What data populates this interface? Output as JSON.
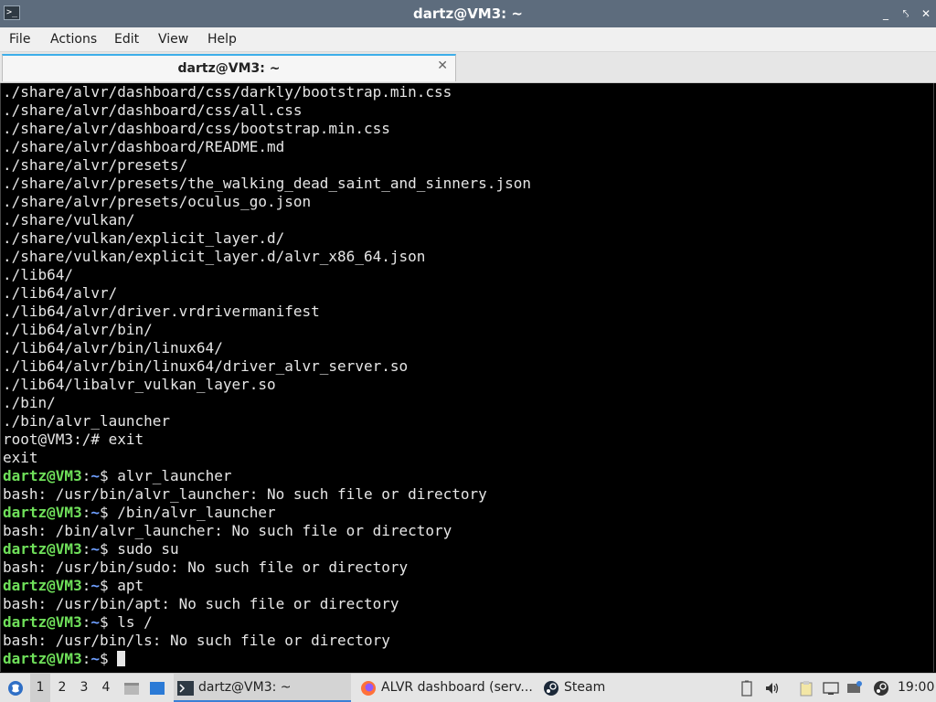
{
  "window": {
    "title": "dartz@VM3: ~",
    "controls": [
      "_",
      "⤣",
      "✕"
    ]
  },
  "menubar": {
    "items": [
      "File",
      "Actions",
      "Edit",
      "View",
      "Help"
    ]
  },
  "tabs": [
    {
      "label": "dartz@VM3: ~",
      "close": "✕"
    }
  ],
  "terminal": {
    "prompt": {
      "user": "dartz@VM3",
      "sep": ":",
      "path": "~",
      "symbol": "$"
    },
    "lines": [
      {
        "text": "./share/alvr/dashboard/css/darkly/bootstrap.min.css"
      },
      {
        "text": "./share/alvr/dashboard/css/all.css"
      },
      {
        "text": "./share/alvr/dashboard/css/bootstrap.min.css"
      },
      {
        "text": "./share/alvr/dashboard/README.md"
      },
      {
        "text": "./share/alvr/presets/"
      },
      {
        "text": "./share/alvr/presets/the_walking_dead_saint_and_sinners.json"
      },
      {
        "text": "./share/alvr/presets/oculus_go.json"
      },
      {
        "text": "./share/vulkan/"
      },
      {
        "text": "./share/vulkan/explicit_layer.d/"
      },
      {
        "text": "./share/vulkan/explicit_layer.d/alvr_x86_64.json"
      },
      {
        "text": "./lib64/"
      },
      {
        "text": "./lib64/alvr/"
      },
      {
        "text": "./lib64/alvr/driver.vrdrivermanifest"
      },
      {
        "text": "./lib64/alvr/bin/"
      },
      {
        "text": "./lib64/alvr/bin/linux64/"
      },
      {
        "text": "./lib64/alvr/bin/linux64/driver_alvr_server.so"
      },
      {
        "text": "./lib64/libalvr_vulkan_layer.so"
      },
      {
        "text": "./bin/"
      },
      {
        "text": "./bin/alvr_launcher"
      },
      {
        "text": "root@VM3:/# exit"
      },
      {
        "text": "exit"
      },
      {
        "prompt": true,
        "command": " alvr_launcher"
      },
      {
        "text": "bash: /usr/bin/alvr_launcher: No such file or directory"
      },
      {
        "prompt": true,
        "command": " /bin/alvr_launcher"
      },
      {
        "text": "bash: /bin/alvr_launcher: No such file or directory"
      },
      {
        "prompt": true,
        "command": " sudo su"
      },
      {
        "text": "bash: /usr/bin/sudo: No such file or directory"
      },
      {
        "prompt": true,
        "command": " apt"
      },
      {
        "text": "bash: /usr/bin/apt: No such file or directory"
      },
      {
        "prompt": true,
        "command": " ls /"
      },
      {
        "text": "bash: /usr/bin/ls: No such file or directory"
      },
      {
        "prompt": true,
        "command": " ",
        "cursor": true
      }
    ]
  },
  "taskbar": {
    "workspaces": [
      "1",
      "2",
      "3",
      "4"
    ],
    "active_workspace": "1",
    "tasks": [
      {
        "label": "dartz@VM3: ~",
        "icon": "terminal-icon",
        "active": true
      },
      {
        "label": "ALVR dashboard (serv...",
        "icon": "firefox-icon",
        "active": false
      },
      {
        "label": "Steam",
        "icon": "steam-icon",
        "active": false
      }
    ],
    "tray_icons": [
      "battery-icon",
      "volume-icon",
      "clipboard-icon",
      "display-icon",
      "network-icon",
      "steam-tray-icon"
    ],
    "clock": "19:00"
  },
  "colors": {
    "titlebar": "#5d6c7d",
    "prompt_user": "#6fe05a",
    "prompt_path": "#6f9fff",
    "terminal_bg": "#000000",
    "terminal_fg": "#e6e6e6"
  }
}
